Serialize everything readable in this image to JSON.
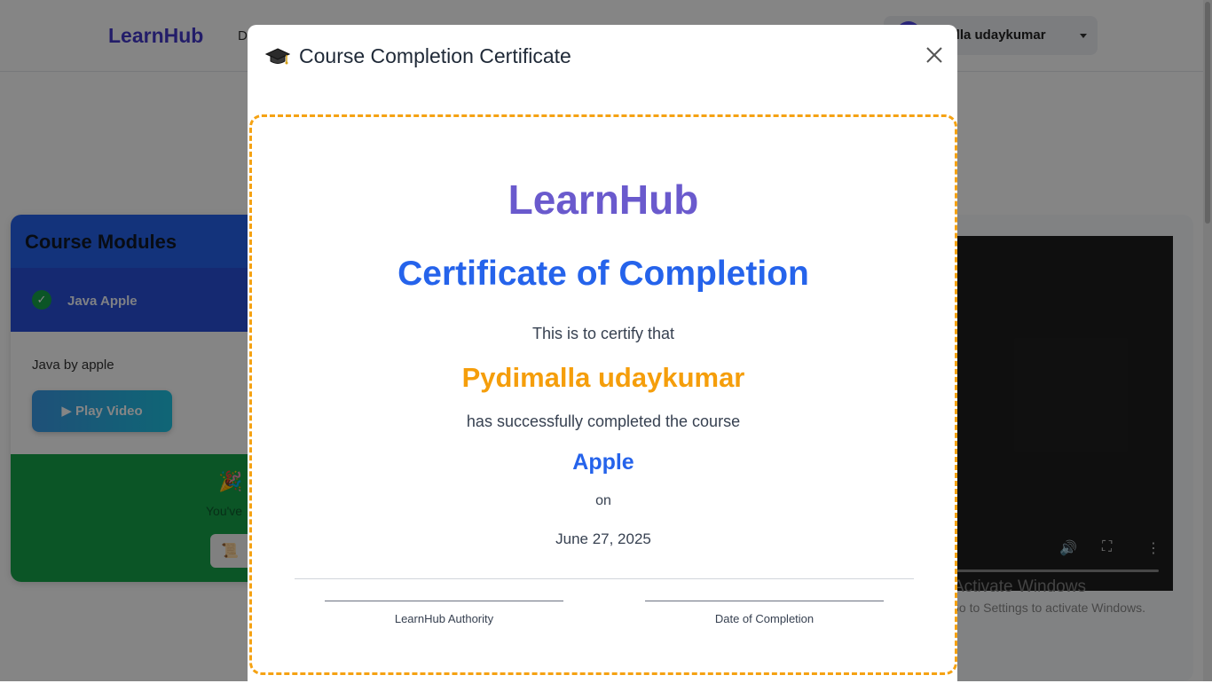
{
  "navbar": {
    "brand": "LearnHub",
    "nav_partial": "D",
    "user_name": "malla udaykumar"
  },
  "modules": {
    "title": "Course Modules",
    "items": [
      {
        "name": "Java Apple",
        "completed": true
      }
    ],
    "description": "Java by apple",
    "play_label": "▶ Play Video",
    "completion_text": "You've",
    "party_icon": "🎉",
    "cert_icon": "📜"
  },
  "watermark": {
    "line1": "Activate Windows",
    "line2": "Go to Settings to activate Windows."
  },
  "modal": {
    "title": "Course Completion Certificate",
    "icon": "graduation-cap-icon",
    "close_icon": "close-icon"
  },
  "certificate": {
    "brand": "LearnHub",
    "heading": "Certificate of Completion",
    "intro": "This is to certify that",
    "recipient": "Pydimalla udaykumar",
    "completed_text": "has successfully completed the course",
    "course": "Apple",
    "on_text": "on",
    "date": "June 27, 2025",
    "signature_left": "LearnHub Authority",
    "signature_right": "Date of Completion"
  },
  "colors": {
    "brand": "#6a5acd",
    "heading": "#2563eb",
    "recipient": "#f59e0b",
    "frame": "#f5a213"
  }
}
